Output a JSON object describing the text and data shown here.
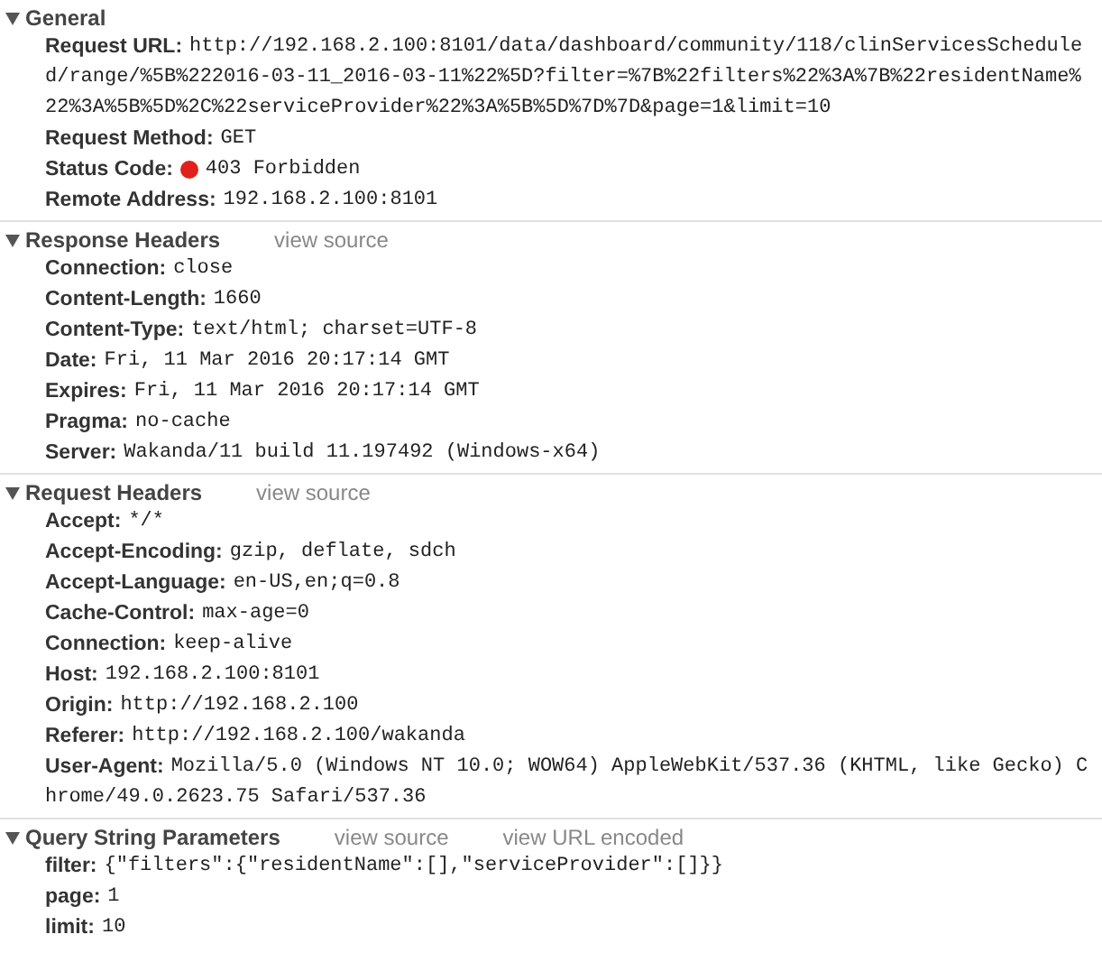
{
  "sections": [
    {
      "title": "General",
      "expanded": true,
      "rows": [
        {
          "name": "Request URL:",
          "value": "http://192.168.2.100:8101/data/dashboard/community/118/clinServicesScheduled/range/%5B%222016-03-11_2016-03-11%22%5D?filter=%7B%22filters%22%3A%7B%22residentName%22%3A%5B%5D%2C%22serviceProvider%22%3A%5B%5D%7D%7D&page=1&limit=10"
        },
        {
          "name": "Request Method:",
          "value": "GET"
        },
        {
          "name": "Status Code:",
          "value": "403 Forbidden",
          "color": "#e0201c"
        },
        {
          "name": "Remote Address:",
          "value": "192.168.2.100:8101"
        }
      ]
    },
    {
      "title": "Response Headers",
      "expanded": true,
      "links": [
        "view source"
      ],
      "rows": [
        {
          "name": "Connection:",
          "value": "close"
        },
        {
          "name": "Content-Length:",
          "value": "1660"
        },
        {
          "name": "Content-Type:",
          "value": "text/html; charset=UTF-8"
        },
        {
          "name": "Date:",
          "value": "Fri, 11 Mar 2016 20:17:14 GMT"
        },
        {
          "name": "Expires:",
          "value": "Fri, 11 Mar 2016 20:17:14 GMT"
        },
        {
          "name": "Pragma:",
          "value": "no-cache"
        },
        {
          "name": "Server:",
          "value": "Wakanda/11 build 11.197492 (Windows-x64)"
        }
      ]
    },
    {
      "title": "Request Headers",
      "expanded": true,
      "links": [
        "view source"
      ],
      "rows": [
        {
          "name": "Accept:",
          "value": "*/*"
        },
        {
          "name": "Accept-Encoding:",
          "value": "gzip, deflate, sdch"
        },
        {
          "name": "Accept-Language:",
          "value": "en-US,en;q=0.8"
        },
        {
          "name": "Cache-Control:",
          "value": "max-age=0"
        },
        {
          "name": "Connection:",
          "value": "keep-alive"
        },
        {
          "name": "Host:",
          "value": "192.168.2.100:8101"
        },
        {
          "name": "Origin:",
          "value": "http://192.168.2.100"
        },
        {
          "name": "Referer:",
          "value": "http://192.168.2.100/wakanda"
        },
        {
          "name": "User-Agent:",
          "value": "Mozilla/5.0 (Windows NT 10.0; WOW64) AppleWebKit/537.36 (KHTML, like Gecko) Chrome/49.0.2623.75 Safari/537.36"
        }
      ]
    },
    {
      "title": "Query String Parameters",
      "expanded": true,
      "links": [
        "view source",
        "view URL encoded"
      ],
      "rows": [
        {
          "name": "filter:",
          "value": "{\"filters\":{\"residentName\":[],\"serviceProvider\":[]}}"
        },
        {
          "name": "page:",
          "value": "1"
        },
        {
          "name": "limit:",
          "value": "10"
        }
      ]
    }
  ]
}
